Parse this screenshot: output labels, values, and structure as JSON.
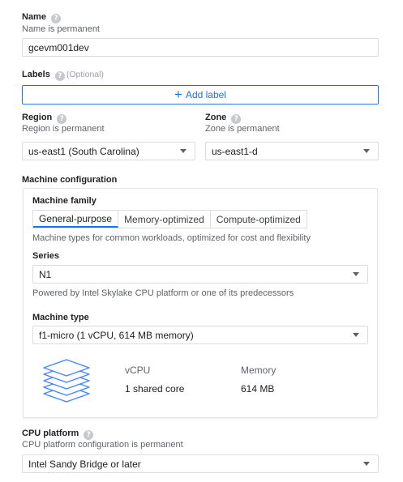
{
  "name": {
    "label": "Name",
    "help_icon": "help-circle-icon",
    "subtext": "Name is permanent",
    "value": "gcevm001dev"
  },
  "labels": {
    "label": "Labels",
    "optional": "(Optional)",
    "add_button": "Add label"
  },
  "region": {
    "label": "Region",
    "subtext": "Region is permanent",
    "value": "us-east1 (South Carolina)"
  },
  "zone": {
    "label": "Zone",
    "subtext": "Zone is permanent",
    "value": "us-east1-d"
  },
  "machine_configuration": {
    "title": "Machine configuration",
    "family_label": "Machine family",
    "tabs": [
      "General-purpose",
      "Memory-optimized",
      "Compute-optimized"
    ],
    "active_tab": "General-purpose",
    "family_description": "Machine types for common workloads, optimized for cost and flexibility",
    "series_label": "Series",
    "series_value": "N1",
    "series_description": "Powered by Intel Skylake CPU platform or one of its predecessors",
    "type_label": "Machine type",
    "type_value": "f1-micro (1 vCPU, 614 MB memory)",
    "vcpu_header": "vCPU",
    "vcpu_value": "1 shared core",
    "memory_header": "Memory",
    "memory_value": "614 MB"
  },
  "cpu_platform": {
    "label": "CPU platform",
    "subtext": "CPU platform configuration is permanent",
    "value": "Intel Sandy Bridge or later"
  },
  "colors": {
    "accent": "#1a73e8",
    "border": "#dadce0",
    "muted_text": "#5f6368"
  }
}
